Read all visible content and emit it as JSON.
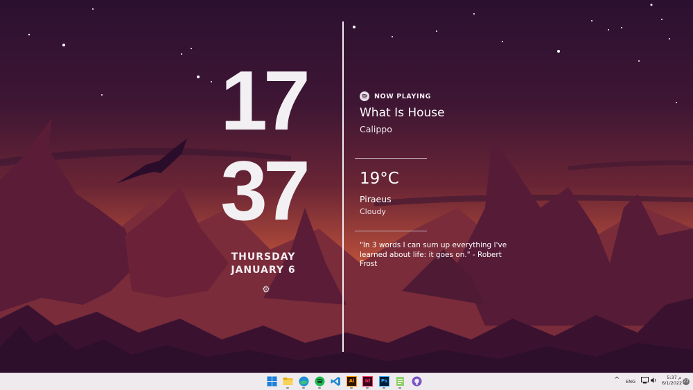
{
  "clock": {
    "hours": "17",
    "minutes": "37",
    "weekday": "THURSDAY",
    "date": "JANUARY 6"
  },
  "icons": {
    "settings": "gear-icon",
    "now_playing": "spotify-icon"
  },
  "now_playing": {
    "label": "NOW PLAYING",
    "track": "What Is House",
    "artist": "Calippo"
  },
  "weather": {
    "temperature": "19°C",
    "city": "Piraeus",
    "condition": "Cloudy"
  },
  "quote": {
    "text": "\"In 3 words I can sum up everything I've learned about life: it goes on.\" - Robert Frost"
  },
  "taskbar": {
    "apps": [
      "start-icon",
      "file-explorer-icon",
      "edge-icon",
      "spotify-icon",
      "vscode-icon",
      "illustrator-icon",
      "indesign-icon",
      "photoshop-icon",
      "notepad-icon",
      "github-icon"
    ],
    "illustrator_label": "Ai",
    "indesign_label": "Id",
    "photoshop_label": "Ps",
    "language": "ENG",
    "time": "5:37 م",
    "date": "6/1/2022",
    "notification_count": "22"
  },
  "colors": {
    "accent": "#f2f0f3",
    "sky_top": "#2e1130",
    "glow": "#c0553a",
    "taskbar": "#efeaee"
  }
}
